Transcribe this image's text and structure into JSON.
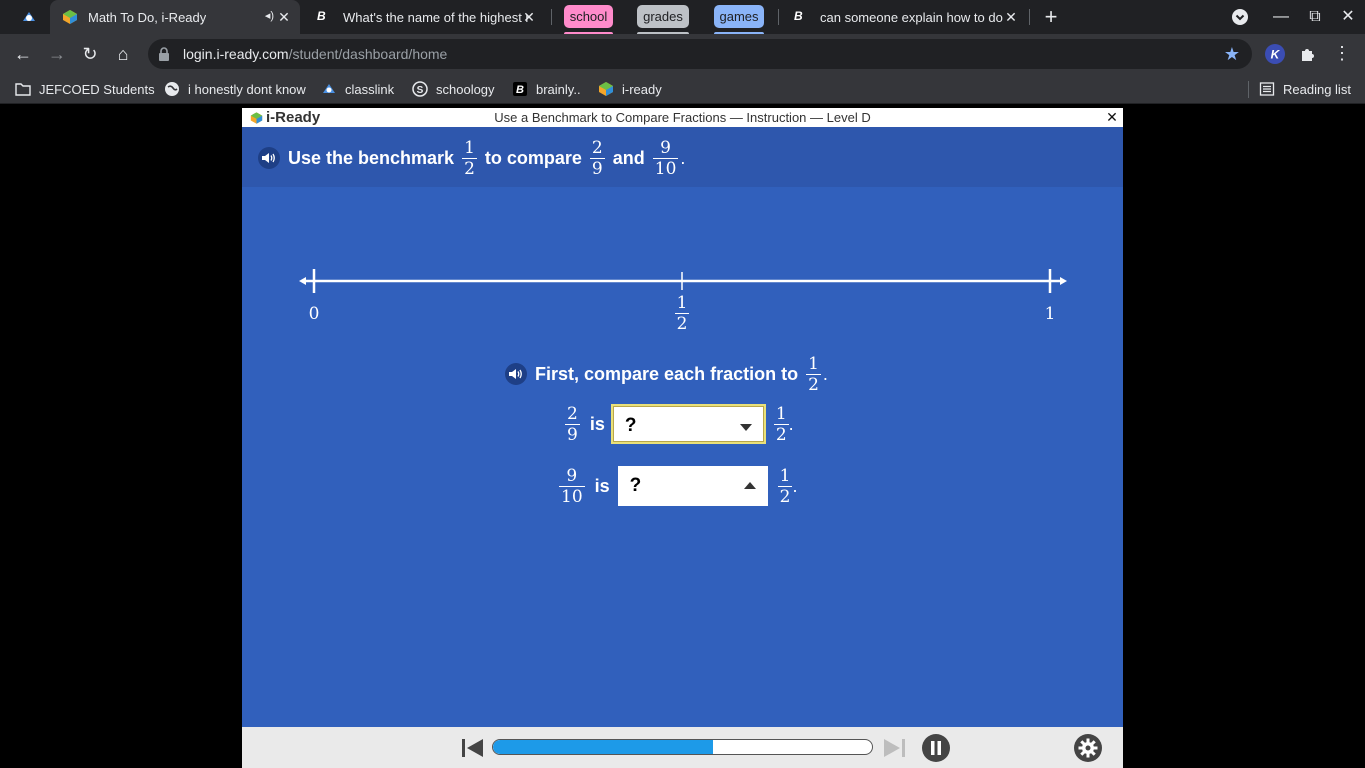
{
  "browser": {
    "tabs": [
      {
        "title": "Math To Do, i-Ready",
        "active": true
      },
      {
        "title": "What's the name of the highest m"
      },
      {
        "title": "can someone explain how to do t"
      }
    ],
    "tab_groups": [
      {
        "label": "school",
        "color": "#ff8bcb"
      },
      {
        "label": "grades",
        "color": "#bdc1c6"
      },
      {
        "label": "games",
        "color": "#8ab4f8"
      }
    ],
    "address": {
      "host": "login.i-ready.com",
      "path": "/student/dashboard/home"
    },
    "bookmarks": [
      {
        "label": "JEFCOED Students",
        "icon": "folder-icon"
      },
      {
        "label": "i honestly dont know",
        "icon": "globe-icon"
      },
      {
        "label": "classlink",
        "icon": "classlink-icon"
      },
      {
        "label": "schoology",
        "icon": "schoology-icon"
      },
      {
        "label": "brainly..",
        "icon": "brainly-icon"
      },
      {
        "label": "i-ready",
        "icon": "iready-icon"
      }
    ],
    "reading_list": "Reading list"
  },
  "app": {
    "logo": "i-Ready",
    "lesson_title": "Use a Benchmark to Compare Fractions — Instruction — Level D",
    "prompt": {
      "part1": "Use the benchmark",
      "benchmark": {
        "num": "1",
        "den": "2"
      },
      "part2": "to compare",
      "frac_a": {
        "num": "2",
        "den": "9"
      },
      "part3": "and",
      "frac_b": {
        "num": "9",
        "den": "10"
      },
      "end": "."
    },
    "number_line": {
      "start_label": "0",
      "mid_label": {
        "num": "1",
        "den": "2"
      },
      "end_label": "1"
    },
    "subprompt": {
      "text": "First, compare each fraction to",
      "frac": {
        "num": "1",
        "den": "2"
      },
      "end": "."
    },
    "rows": [
      {
        "frac": {
          "num": "2",
          "den": "9"
        },
        "word": "is",
        "dropdown_value": "?",
        "rhs": {
          "num": "1",
          "den": "2"
        },
        "end": "."
      },
      {
        "frac": {
          "num": "9",
          "den": "10"
        },
        "word": "is",
        "dropdown_value": "?",
        "rhs": {
          "num": "1",
          "den": "2"
        },
        "end": "."
      }
    ],
    "progress_percent": 58
  }
}
